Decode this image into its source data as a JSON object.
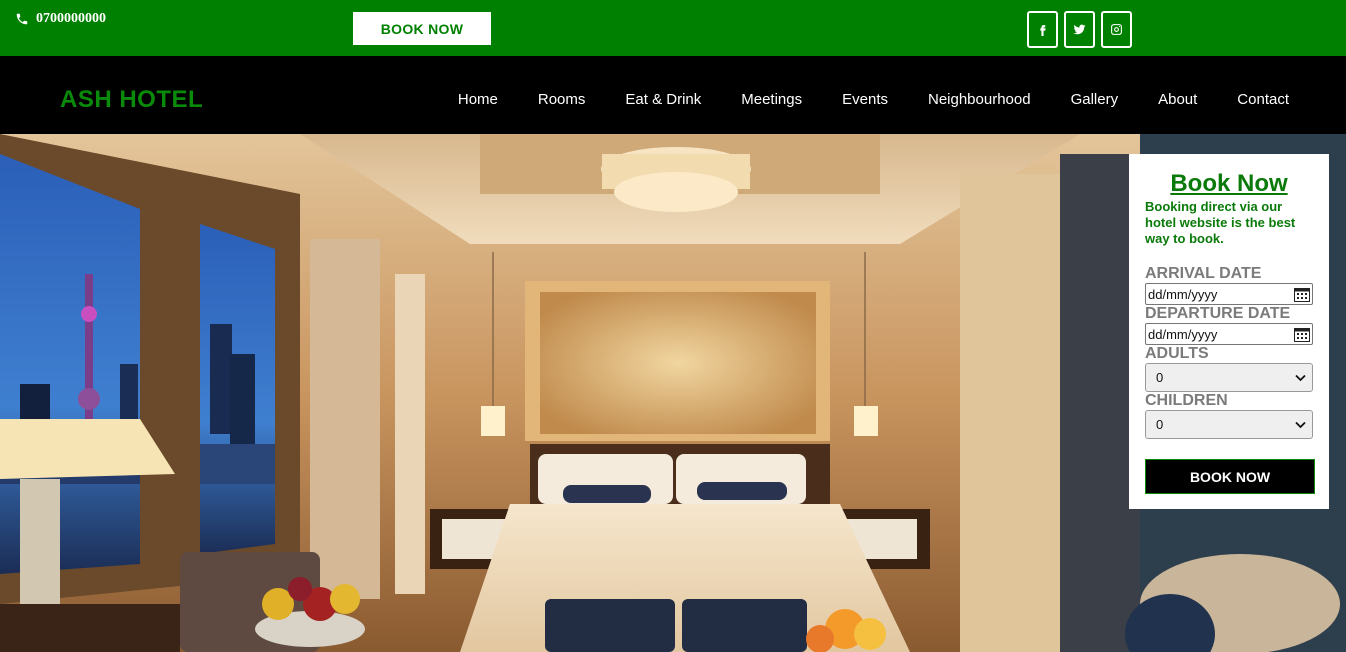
{
  "topbar": {
    "phone": "0700000000",
    "book_label": "BOOK NOW",
    "socials": [
      "facebook-icon",
      "twitter-icon",
      "instagram-icon"
    ],
    "color": "#008000"
  },
  "header": {
    "logo": "ASH HOTEL",
    "nav": [
      "Home",
      "Rooms",
      "Eat & Drink",
      "Meetings",
      "Events",
      "Neighbourhood",
      "Gallery",
      "About",
      "Contact"
    ]
  },
  "booking": {
    "title": "Book Now",
    "subtitle": "Booking direct via our hotel website is the best way to book.",
    "arrival_label": "ARRIVAL DATE",
    "arrival_value": "dd/mm/yyyy",
    "departure_label": "DEPARTURE DATE",
    "departure_value": "dd/mm/yyyy",
    "adults_label": "ADULTS",
    "adults_value": "0",
    "children_label": "CHILDREN",
    "children_value": "0",
    "button_label": "BOOK NOW"
  }
}
